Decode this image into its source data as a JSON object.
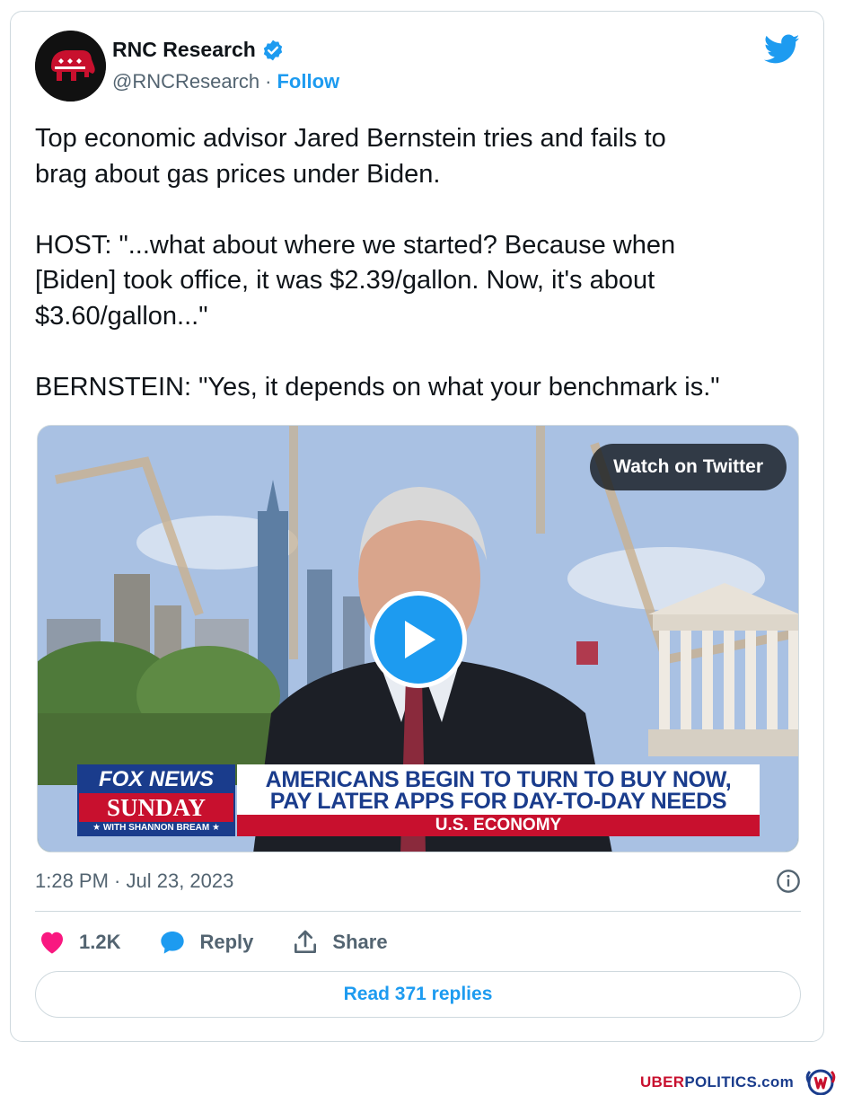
{
  "author": {
    "name": "RNC Research",
    "handle": "@RNCResearch",
    "separator": "·",
    "follow_label": "Follow"
  },
  "tweet": {
    "text": "Top economic advisor Jared Bernstein tries and fails to\nbrag about gas prices under Biden.\n\nHOST: \"...what about where we started? Because when\n[Biden] took office, it was $2.39/gallon. Now, it's about\n$3.60/gallon...\"\n\nBERNSTEIN: \"Yes, it depends on what your benchmark is.\"",
    "timestamp": "1:28 PM · Jul 23, 2023"
  },
  "media": {
    "watch_label": "Watch on Twitter",
    "chyron": {
      "network": "FOX NEWS",
      "show": "SUNDAY",
      "host_line": "★ WITH SHANNON BREAM ★",
      "headline_1": "AMERICANS BEGIN TO TURN TO BUY NOW,",
      "headline_2": "PAY LATER APPS FOR DAY-TO-DAY NEEDS",
      "section": "U.S. ECONOMY"
    }
  },
  "actions": {
    "likes": "1.2K",
    "reply_label": "Reply",
    "share_label": "Share"
  },
  "read_replies_label": "Read 371 replies",
  "watermark": {
    "uber": "UBER",
    "politics": "POLITICS.com"
  },
  "colors": {
    "twitter_blue": "#1d9bf0",
    "like_pink": "#f91880",
    "text_secondary": "#536471",
    "fox_blue": "#1a3c8c",
    "fox_red": "#c8102e"
  }
}
